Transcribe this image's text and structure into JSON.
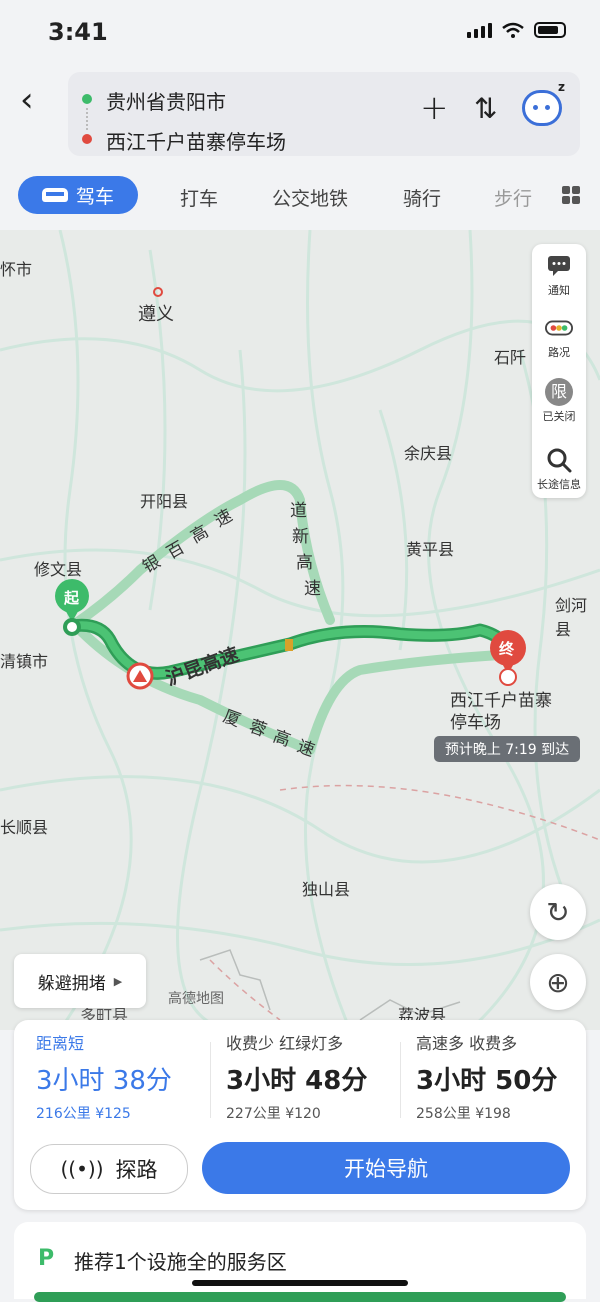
{
  "status": {
    "time": "3:41"
  },
  "header": {
    "from": "贵州省贵阳市",
    "to": "西江千户苗寨停车场"
  },
  "tabs": {
    "active": "驾车",
    "items": [
      "打车",
      "公交地铁",
      "骑行",
      "步行"
    ]
  },
  "map": {
    "cities": {
      "huaishi": "怀市",
      "zunyi": "遵义",
      "shiqian": "石阡",
      "yuqing": "余庆县",
      "kaiyang": "开阳县",
      "huangping": "黄平县",
      "jianhe": "剑河县",
      "xiuwen": "修文县",
      "qingzhen": "清镇市",
      "changshun": "长顺县",
      "dushan": "独山县",
      "libo": "荔波县",
      "duyun": "多町县",
      "gaode": "高德地图"
    },
    "roads": {
      "yinbai": [
        "银",
        "百",
        "高",
        "速"
      ],
      "daoxin": [
        "道",
        "新",
        "高",
        "速"
      ],
      "hukun": "沪昆高速",
      "xiarong": [
        "厦",
        "蓉",
        "高",
        "速"
      ]
    },
    "start_marker": "起",
    "end_marker": "终",
    "destination_label_line1": "西江千户苗寨",
    "destination_label_line2": "停车场",
    "eta": "预计晚上 7:19 到达",
    "side_tools": [
      "通知",
      "路况",
      "已关闭",
      "长途信息"
    ],
    "limit_badge": "限",
    "avoid_button": "躲避拥堵"
  },
  "routes": [
    {
      "tag": "距离短",
      "duration": "3小时 38分",
      "distance": "216公里",
      "fee": "¥125",
      "selected": true
    },
    {
      "tag": "收费少  红绿灯多",
      "duration": "3小时 48分",
      "distance": "227公里",
      "fee": "¥120",
      "selected": false
    },
    {
      "tag": "高速多  收费多",
      "duration": "3小时 50分",
      "distance": "258公里",
      "fee": "¥198",
      "selected": false
    }
  ],
  "actions": {
    "explore": "探路",
    "start": "开始导航"
  },
  "service": {
    "icon": "P",
    "text": "推荐1个设施全的服务区"
  },
  "colors": {
    "route_green": "#3dbb6a",
    "accent_blue": "#3b79e8",
    "dest_red": "#e04a3f"
  }
}
